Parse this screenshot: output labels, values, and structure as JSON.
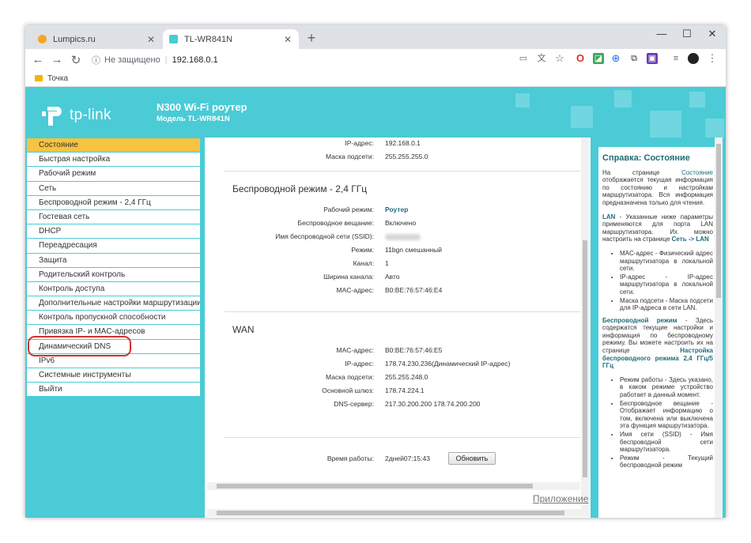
{
  "browser": {
    "tabs": [
      {
        "title": "Lumpics.ru",
        "favicon_color": "#f5a623"
      },
      {
        "title": "TL-WR841N",
        "favicon_color": "#4acbd6"
      }
    ],
    "new_tab": "+",
    "window_controls": {
      "minimize": "—",
      "maximize": "☐",
      "close": "✕"
    },
    "nav": {
      "back": "←",
      "forward": "→",
      "reload": "↻"
    },
    "address": {
      "security": "Не защищено",
      "url": "192.168.0.1"
    },
    "bookmarks": [
      {
        "label": "Точка"
      }
    ]
  },
  "router": {
    "brand": "tp-link",
    "model_title": "N300 Wi-Fi роутер",
    "model_subtitle": "Модель TL-WR841N",
    "accent_color": "#4acbd6"
  },
  "menu": {
    "items": [
      {
        "label": "Состояние"
      },
      {
        "label": "Быстрая настройка"
      },
      {
        "label": "Рабочий режим"
      },
      {
        "label": "Сеть"
      },
      {
        "label": "Беспроводной режим - 2,4 ГГц"
      },
      {
        "label": "Гостевая сеть"
      },
      {
        "label": "DHCP"
      },
      {
        "label": "Переадресация"
      },
      {
        "label": "Защита"
      },
      {
        "label": "Родительский контроль"
      },
      {
        "label": "Контроль доступа"
      },
      {
        "label": "Дополнительные настройки маршрутизации"
      },
      {
        "label": "Контроль пропускной способности"
      },
      {
        "label": "Привязка IP- и MAC-адресов"
      },
      {
        "label": "Динамический DNS"
      },
      {
        "label": "IPv6"
      },
      {
        "label": "Системные инструменты"
      },
      {
        "label": "Выйти"
      }
    ]
  },
  "lan": {
    "ip_label": "IP-адрес:",
    "ip_value": "192.168.0.1",
    "mask_label": "Маска подсети:",
    "mask_value": "255.255.255.0"
  },
  "wireless": {
    "title": "Беспроводной режим - 2,4 ГГц",
    "mode_label": "Рабочий режим:",
    "mode_value": "Роутер",
    "broadcast_label": "Беспроводное вещание:",
    "broadcast_value": "Включено",
    "ssid_label": "Имя беспроводной сети (SSID):",
    "radio_label": "Режим:",
    "radio_value": "11bgn смешанный",
    "channel_label": "Канал:",
    "channel_value": "1",
    "width_label": "Ширина канала:",
    "width_value": "Авто",
    "mac_label": "MAC-адрес:",
    "mac_value": "B0:BE:76:57:46:E4"
  },
  "wan": {
    "title": "WAN",
    "mac_label": "MAC-адрес:",
    "mac_value": "B0:BE:76:57:46:E5",
    "ip_label": "IP-адрес:",
    "ip_value": "178.74.230.236(Динамический IP-адрес)",
    "mask_label": "Маска подсети:",
    "mask_value": "255.255.248.0",
    "gateway_label": "Основной шлюз:",
    "gateway_value": "178.74.224.1",
    "dns_label": "DNS-сервер:",
    "dns_value": "217.30.200.200 178.74.200.200"
  },
  "uptime": {
    "label": "Время работы:",
    "value": "2дней07:15:43",
    "refresh_button": "Обновить"
  },
  "app_link": "Приложение",
  "help": {
    "title": "Справка: Состояние",
    "intro_pre": "На странице ",
    "intro_link": "Состояние",
    "intro_post": " отображается текущая информация по состоянию и настройкам маршрутизатора. Вся информация предназначена только для чтения.",
    "lan_title": "LAN",
    "lan_text": " - Указанные ниже параметры применяются для порта LAN маршрутизатора. Их можно настроить на странице ",
    "lan_link": "Сеть -> LAN",
    "lan_items": [
      "MAC-адрес - Физический адрес маршрутизатора в локальной сети.",
      "IP-адрес - IP-адрес маршрутизатора в локальной сети.",
      "Маска подсети - Маска подсети для IP-адреса в сети LAN."
    ],
    "wl_title": "Беспроводной режим",
    "wl_text": " - Здесь содержатся текущие настройки и информация по беспроводному режиму. Вы можете настроить их на странице ",
    "wl_link": "Настройка беспроводного режима 2,4 ГГц/5 ГГц",
    "wl_items": [
      "Режим работы - Здесь указано, в каком режиме устройство работает в данный момент.",
      "Беспроводное вещание - Отображает информацию о том, включена или выключена эта функция маршрутизатора.",
      "Имя сети (SSID) - Имя беспроводной сети маршрутизатора.",
      "Режим - Текущий беспроводной режим"
    ]
  }
}
